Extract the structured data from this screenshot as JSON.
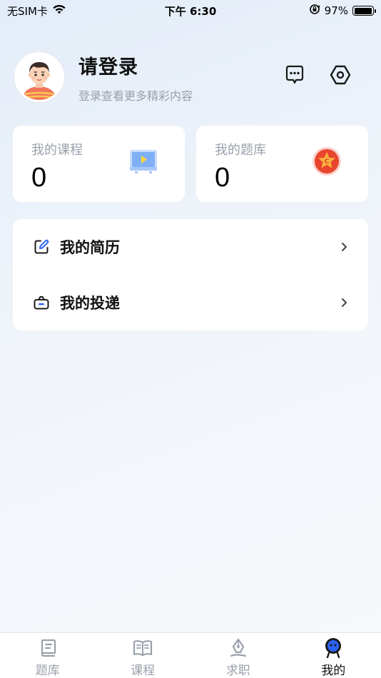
{
  "status_bar": {
    "carrier": "无SIM卡",
    "time": "下午 6:30",
    "battery_percent": "97%",
    "battery_level": 0.97
  },
  "profile": {
    "title": "请登录",
    "subtitle": "登录查看更多精彩内容"
  },
  "stats": {
    "courses_label": "我的课程",
    "courses_value": "0",
    "questions_label": "我的题库",
    "questions_value": "0"
  },
  "menu": {
    "resume_label": "我的简历",
    "delivery_label": "我的投递"
  },
  "tabs": [
    {
      "label": "题库",
      "icon": "question-bank-icon",
      "active": false
    },
    {
      "label": "课程",
      "icon": "course-book-icon",
      "active": false
    },
    {
      "label": "求职",
      "icon": "pen-nib-icon",
      "active": false
    },
    {
      "label": "我的",
      "icon": "profile-mascot-icon",
      "active": true
    }
  ],
  "colors": {
    "accent_blue": "#2b63f6",
    "muted_text": "#9aa1ab",
    "badge_red": "#e8452f"
  }
}
